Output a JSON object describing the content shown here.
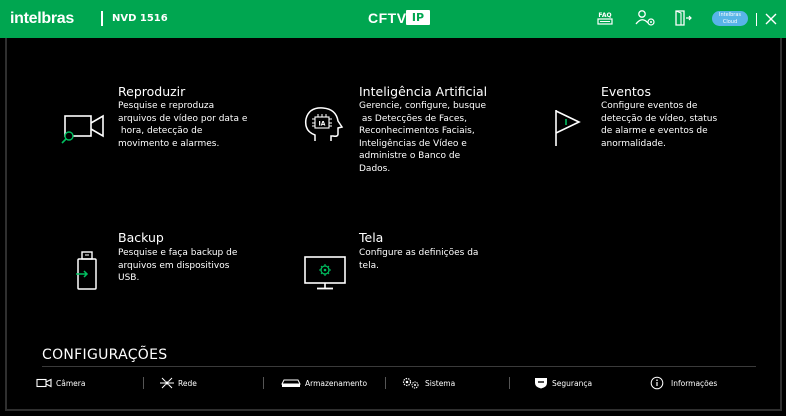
{
  "header": {
    "logo": "intelbras",
    "model": "NVD 1516",
    "center_title": "CFTV",
    "center_badge": "IP",
    "cloud_label_1": "Intelbras",
    "cloud_label_2": "Cloud",
    "close": "×",
    "bg_color": "#00a650"
  },
  "tiles": [
    {
      "title": "Reproduzir",
      "desc": [
        "Pesquise e reproduza",
        "arquivos de vídeo por data e",
        " hora, detecção de",
        "movimento e alarmes."
      ]
    },
    {
      "title": "Inteligência Artificial",
      "desc": [
        "Gerencie, configure, busque",
        " as Detecções de Faces,",
        "Reconhecimentos Faciais,",
        "Inteligências de Vídeo e",
        "administre o Banco de",
        "Dados."
      ],
      "icon_badge": "IA"
    },
    {
      "title": "Eventos",
      "desc": [
        "Configure eventos de",
        "detecção de vídeo, status",
        "de alarme e eventos de",
        "anormalidade."
      ]
    },
    {
      "title": "Backup",
      "desc": [
        "Pesquise e faça backup de",
        "arquivos em dispositivos",
        "USB."
      ]
    },
    {
      "title": "Tela",
      "desc": [
        "Configure as definições da",
        "tela."
      ]
    }
  ],
  "config": {
    "title": "CONFIGURAÇÕES",
    "items": [
      {
        "label": "Câmera",
        "icon": "camera-icon"
      },
      {
        "label": "Rede",
        "icon": "network-icon"
      },
      {
        "label": "Armazenamento",
        "icon": "hdd-icon"
      },
      {
        "label": "Sistema",
        "icon": "gears-icon"
      },
      {
        "label": "Segurança",
        "icon": "shield-icon"
      },
      {
        "label": "Informações",
        "icon": "info-icon"
      }
    ]
  }
}
